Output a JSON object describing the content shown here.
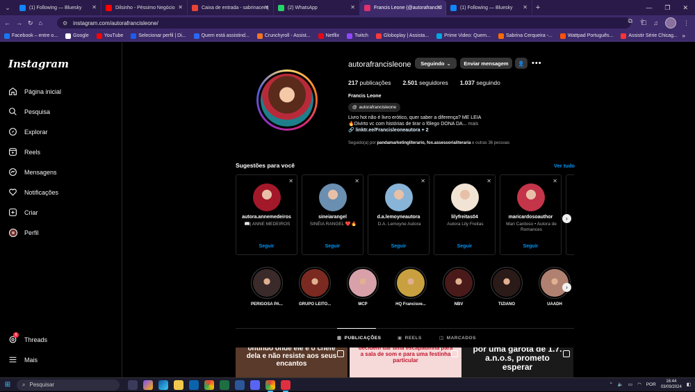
{
  "browser": {
    "tabs": [
      {
        "title": "(1) Following — Bluesky",
        "color": "#1185fe",
        "active": false
      },
      {
        "title": "Dilsinho - Péssimo Negócio",
        "color": "#ff0000",
        "active": false
      },
      {
        "title": "Caixa de entrada - sabrinacerq",
        "color": "#ea4335",
        "active": false
      },
      {
        "title": "(2) WhatsApp",
        "color": "#25d366",
        "active": false
      },
      {
        "title": "Francis Leone (@autorafrancisl",
        "color": "#e1306c",
        "active": true
      },
      {
        "title": "(1) Following — Bluesky",
        "color": "#1185fe",
        "active": false
      }
    ],
    "url": "instagram.com/autorafrancisleone/",
    "bookmarks": [
      {
        "label": "Facebook – entre o...",
        "color": "#1877f2"
      },
      {
        "label": "Google",
        "color": "#ffffff"
      },
      {
        "label": "YouTube",
        "color": "#ff0000"
      },
      {
        "label": "Selecionar perfil | Di...",
        "color": "#1a5ef0"
      },
      {
        "label": "Quem está assistind...",
        "color": "#2b67f6"
      },
      {
        "label": "Crunchyroll - Assist...",
        "color": "#f47521"
      },
      {
        "label": "Netflix",
        "color": "#e50914"
      },
      {
        "label": "Twitch",
        "color": "#9146ff"
      },
      {
        "label": "Globoplay | Assista...",
        "color": "#f83a3a"
      },
      {
        "label": "Prime Video: Quem...",
        "color": "#00a8e1"
      },
      {
        "label": "Sabrina Cerqueira -...",
        "color": "#ff6a00"
      },
      {
        "label": "Wattpad Português...",
        "color": "#ff500a"
      },
      {
        "label": "Assistir Série Chicag...",
        "color": "#ff3333"
      }
    ]
  },
  "sidebar": {
    "logo": "Instagram",
    "items": [
      {
        "label": "Página inicial",
        "icon": "home-icon"
      },
      {
        "label": "Pesquisa",
        "icon": "search-icon"
      },
      {
        "label": "Explorar",
        "icon": "compass-icon"
      },
      {
        "label": "Reels",
        "icon": "reels-icon"
      },
      {
        "label": "Mensagens",
        "icon": "messenger-icon"
      },
      {
        "label": "Notificações",
        "icon": "heart-icon"
      },
      {
        "label": "Criar",
        "icon": "plus-icon"
      },
      {
        "label": "Perfil",
        "icon": "avatar-icon"
      }
    ],
    "threads": {
      "label": "Threads",
      "badge": "6"
    },
    "more": "Mais"
  },
  "profile": {
    "username": "autorafrancisleone",
    "following_button": "Seguindo",
    "message_button": "Enviar mensagem",
    "stats": {
      "posts_count": "217",
      "posts_label": "publicações",
      "followers_count": "2.501",
      "followers_label": "seguidores",
      "following_count": "1.037",
      "following_label": "seguindo"
    },
    "full_name": "Francis Leone",
    "threads_handle": "autorafrancisleone",
    "bio_line1": "Livro hot não é livro erótico, quer saber a diferença? ME LEIA",
    "bio_line2": "🔥Divirto vc com histórias de tirar o fôlego DONA DA...",
    "bio_more": "mais",
    "bio_link": "linktr.ee/Francisleoneautora + 2",
    "mutual_prefix": "Seguido(a) por",
    "mutual_names": "pandamarketingliterario, fox.assessorialiteraria",
    "mutual_suffix": "e outras 36 pessoas"
  },
  "suggestions": {
    "title": "Sugestões para você",
    "see_all": "Ver tudo",
    "follow_label": "Seguir",
    "cards": [
      {
        "name": "autora.annemedeiros",
        "sub": "📖| ANNE MEDEIROS",
        "color": "#a3192a"
      },
      {
        "name": "sineiarangel",
        "sub": "SINÉIA RANGEL ❤️🔥",
        "color": "#6a8fb0"
      },
      {
        "name": "d.a.lemoyneautora",
        "sub": "D.A. Lemoyne Autora",
        "color": "#88b4d8"
      },
      {
        "name": "lilyfreitas04",
        "sub": "Autora Lily Freitas",
        "color": "#f2e4d4"
      },
      {
        "name": "maricardosoauthor",
        "sub": "Mari Cardoso • Autora de Romances",
        "color": "#c4354a"
      }
    ]
  },
  "highlights": [
    {
      "name": "PERIGOSA PA...",
      "color": "#3a2a2a"
    },
    {
      "name": "GRUPO LEITO...",
      "color": "#7a2a20"
    },
    {
      "name": "MCP",
      "color": "#d8a0a8"
    },
    {
      "name": "HQ Francisve...",
      "color": "#c8a040"
    },
    {
      "name": "NBV",
      "color": "#4a1a1a"
    },
    {
      "name": "TIZIANO",
      "color": "#2a1a18"
    },
    {
      "name": "UAADH",
      "color": "#b08070"
    }
  ],
  "content_tabs": [
    "PUBLICAÇÕES",
    "REELS",
    "MARCADOS"
  ],
  "posts": [
    {
      "text": "ontinuo onde ele é o chefe dela e não resiste aos seus encantos",
      "bg": "#5a3a2a",
      "fg": "#ffffff"
    },
    {
      "text": "decidem dar uma escapadinha para a sala de som e para uma festinha particular",
      "bg": "#f6d9d9",
      "fg": "#c0162e"
    },
    {
      "text": "por uma garota de 1.7. a.n.o.s, prometo esperar",
      "bg": "#1a1a1a",
      "fg": "#ffffff"
    }
  ],
  "taskbar": {
    "search_placeholder": "Pesquisar",
    "lang": "POR",
    "time": "16:44",
    "date": "03/09/2024"
  }
}
